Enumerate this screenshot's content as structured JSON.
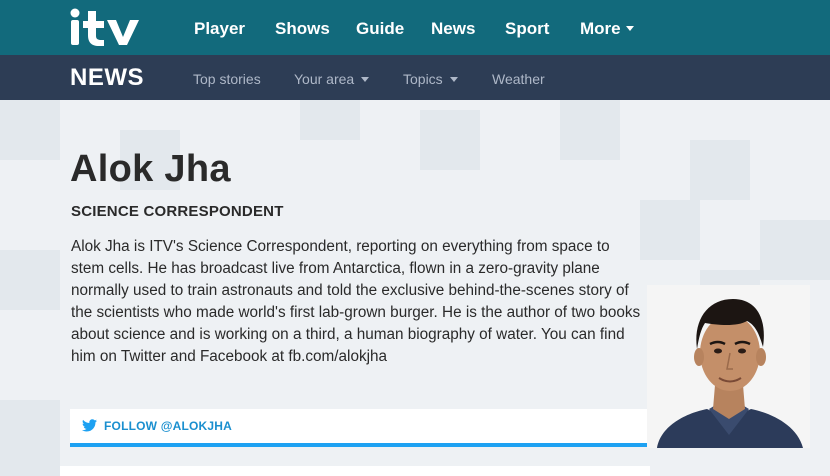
{
  "header": {
    "logo_text": "itv",
    "nav": [
      {
        "label": "Player"
      },
      {
        "label": "Shows"
      },
      {
        "label": "Guide"
      },
      {
        "label": "News"
      },
      {
        "label": "Sport"
      },
      {
        "label": "More"
      }
    ]
  },
  "newsbar": {
    "brand": "NEWS",
    "items": [
      {
        "label": "Top stories"
      },
      {
        "label": "Your area"
      },
      {
        "label": "Topics"
      },
      {
        "label": "Weather"
      }
    ]
  },
  "profile": {
    "name": "Alok Jha",
    "role": "SCIENCE CORRESPONDENT",
    "bio": "Alok Jha is ITV's Science Correspondent, reporting on everything from space to stem cells. He has broadcast live from Antarctica, flown in a zero-gravity plane normally used to train astronauts and told the exclusive behind-the-scenes story of the scientists who made world's first lab-grown burger. He is the author of two books about science and is working on a third, a human biography of water. You can find him on Twitter and Facebook at fb.com/alokjha",
    "follow_label": "FOLLOW @ALOKJHA"
  },
  "colors": {
    "topbar": "#126a7c",
    "newsbar": "#2d3d55",
    "twitter": "#1da1f2",
    "page_bg": "#eef1f4"
  },
  "icons": {
    "twitter": "twitter-bird-icon",
    "dropdown": "chevron-down-icon"
  }
}
